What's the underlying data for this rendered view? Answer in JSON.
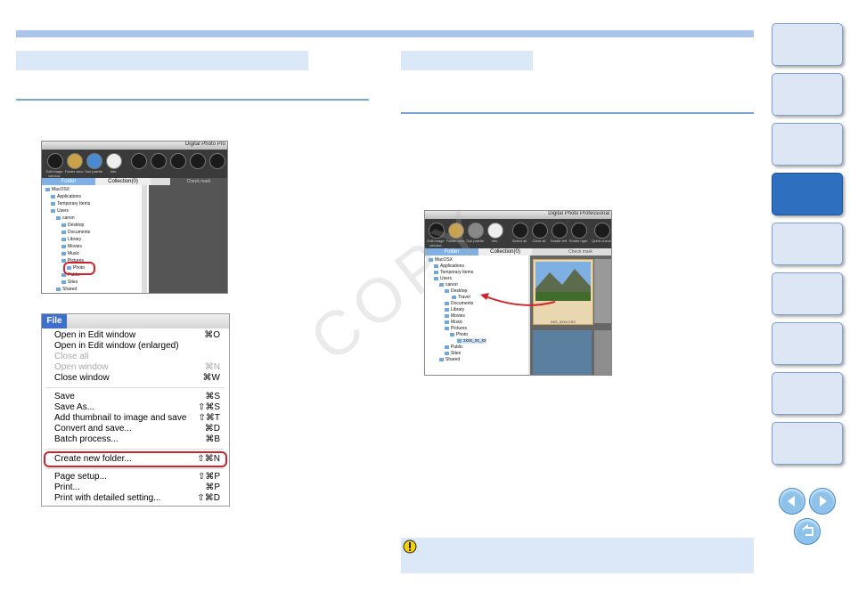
{
  "side_tabs": [
    "",
    "",
    "",
    "",
    "",
    "",
    "",
    "",
    ""
  ],
  "shot1": {
    "title": "Digital Photo Pro",
    "toolbar": [
      "Edit image window",
      "Folder view",
      "Tool palette",
      "Info",
      "",
      "",
      "",
      "",
      ""
    ],
    "tabs": {
      "folder": "Folder",
      "collection": "Collection(0)"
    },
    "check_mark_label": "Check mark",
    "tree": [
      "MacOSX",
      "Applications",
      "Temporary Items",
      "Users",
      "canon",
      "Desktop",
      "Documents",
      "Library",
      "Movies",
      "Music",
      "Pictures",
      "Photo",
      "Public",
      "Sites",
      "Shared"
    ]
  },
  "menu": {
    "title": "File",
    "items": [
      {
        "label": "Open in Edit window",
        "shortcut": "⌘O",
        "disabled": false
      },
      {
        "label": "Open in Edit window (enlarged)",
        "shortcut": "",
        "disabled": false
      },
      {
        "label": "Close all",
        "shortcut": "",
        "disabled": true
      },
      {
        "label": "Open window",
        "shortcut": "⌘N",
        "disabled": true
      },
      {
        "label": "Close window",
        "shortcut": "⌘W",
        "disabled": false
      },
      {
        "label": "Save",
        "shortcut": "⌘S",
        "disabled": false
      },
      {
        "label": "Save As...",
        "shortcut": "⇧⌘S",
        "disabled": false
      },
      {
        "label": "Add thumbnail to image and save",
        "shortcut": "⇧⌘T",
        "disabled": false
      },
      {
        "label": "Convert and save...",
        "shortcut": "⌘D",
        "disabled": false
      },
      {
        "label": "Batch process...",
        "shortcut": "⌘B",
        "disabled": false
      },
      {
        "label": "Create new folder...",
        "shortcut": "⇧⌘N",
        "disabled": false
      },
      {
        "label": "Page setup...",
        "shortcut": "⇧⌘P",
        "disabled": false
      },
      {
        "label": "Print...",
        "shortcut": "⌘P",
        "disabled": false
      },
      {
        "label": "Print with detailed setting...",
        "shortcut": "⇧⌘D",
        "disabled": false
      }
    ]
  },
  "shot2": {
    "title": "Digital Photo Professional",
    "toolbar": [
      "Edit image window",
      "Folder view",
      "Tool palette",
      "Info",
      "Select all",
      "Clear all",
      "Rotate left",
      "Rotate right",
      "Quick check"
    ],
    "tabs": {
      "folder": "Folder",
      "collection": "Collection(0)"
    },
    "check_mark_label": "Check mark",
    "tree": [
      "MacOSX",
      "Applications",
      "Temporary Items",
      "Users",
      "canon",
      "Desktop",
      "Travel",
      "Documents",
      "Library",
      "Movies",
      "Music",
      "Pictures",
      "Photo",
      "xxxx_xx_xx",
      "Public",
      "Sites",
      "Shared"
    ],
    "thumb_caption": "IMG_0015.CR2"
  },
  "watermark": "COPY",
  "colors": {
    "accent": "#3d6fd0",
    "highlight_red": "#d2232a",
    "section_blue": "#dbe8f7"
  }
}
